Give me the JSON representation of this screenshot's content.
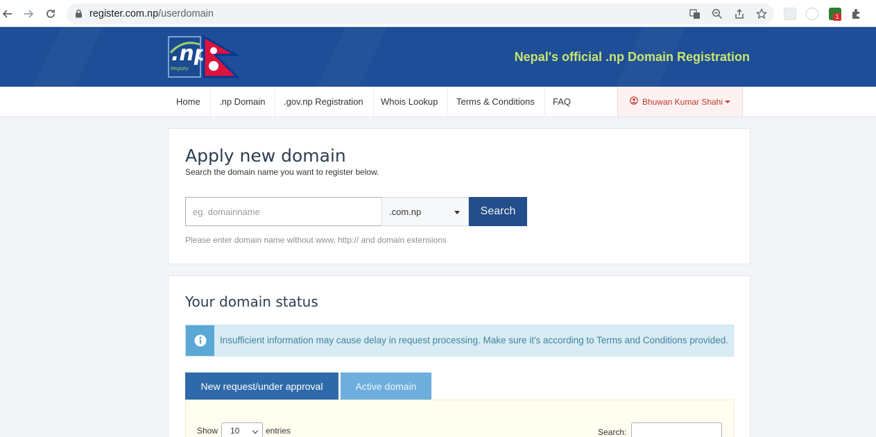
{
  "browser": {
    "url_host": "register.com.np",
    "url_path": "/userdomain",
    "extension_badge": "1"
  },
  "header": {
    "logo_text": ".np",
    "logo_subtext": "Registry",
    "title": "Nepal's official .np Domain Registration"
  },
  "nav": {
    "items": [
      {
        "label": "Home"
      },
      {
        "label": ".np Domain"
      },
      {
        "label": ".gov.np Registration"
      },
      {
        "label": "Whois Lookup"
      },
      {
        "label": "Terms & Conditions"
      },
      {
        "label": "FAQ"
      }
    ],
    "user_name": "Bhuwan Kumar Shahi"
  },
  "apply": {
    "title": "Apply new domain",
    "subtitle": "Search the domain name you want to register below.",
    "input_placeholder": "eg. domainname",
    "extension_selected": ".com.np",
    "search_label": "Search",
    "hint": "Please enter domain name without www, http:// and domain extensions"
  },
  "status": {
    "title": "Your domain status",
    "alert_text": "Insufficient information may cause delay in request processing. Make sure it's according to Terms and Conditions provided.",
    "tabs": [
      {
        "label": "New request/under approval",
        "active": true
      },
      {
        "label": "Active domain",
        "active": false
      }
    ],
    "show_label": "Show",
    "page_size": "10",
    "entries_label": "entries",
    "search_label": "Search:"
  },
  "colors": {
    "header_bg": "#1e4e97",
    "header_title": "#c8e66e",
    "primary_button": "#234d8b",
    "tab_active": "#2e6aaa",
    "tab_inactive": "#6eaedc",
    "alert_bg": "#d8ecf4",
    "user_menu_text": "#c0392b"
  }
}
